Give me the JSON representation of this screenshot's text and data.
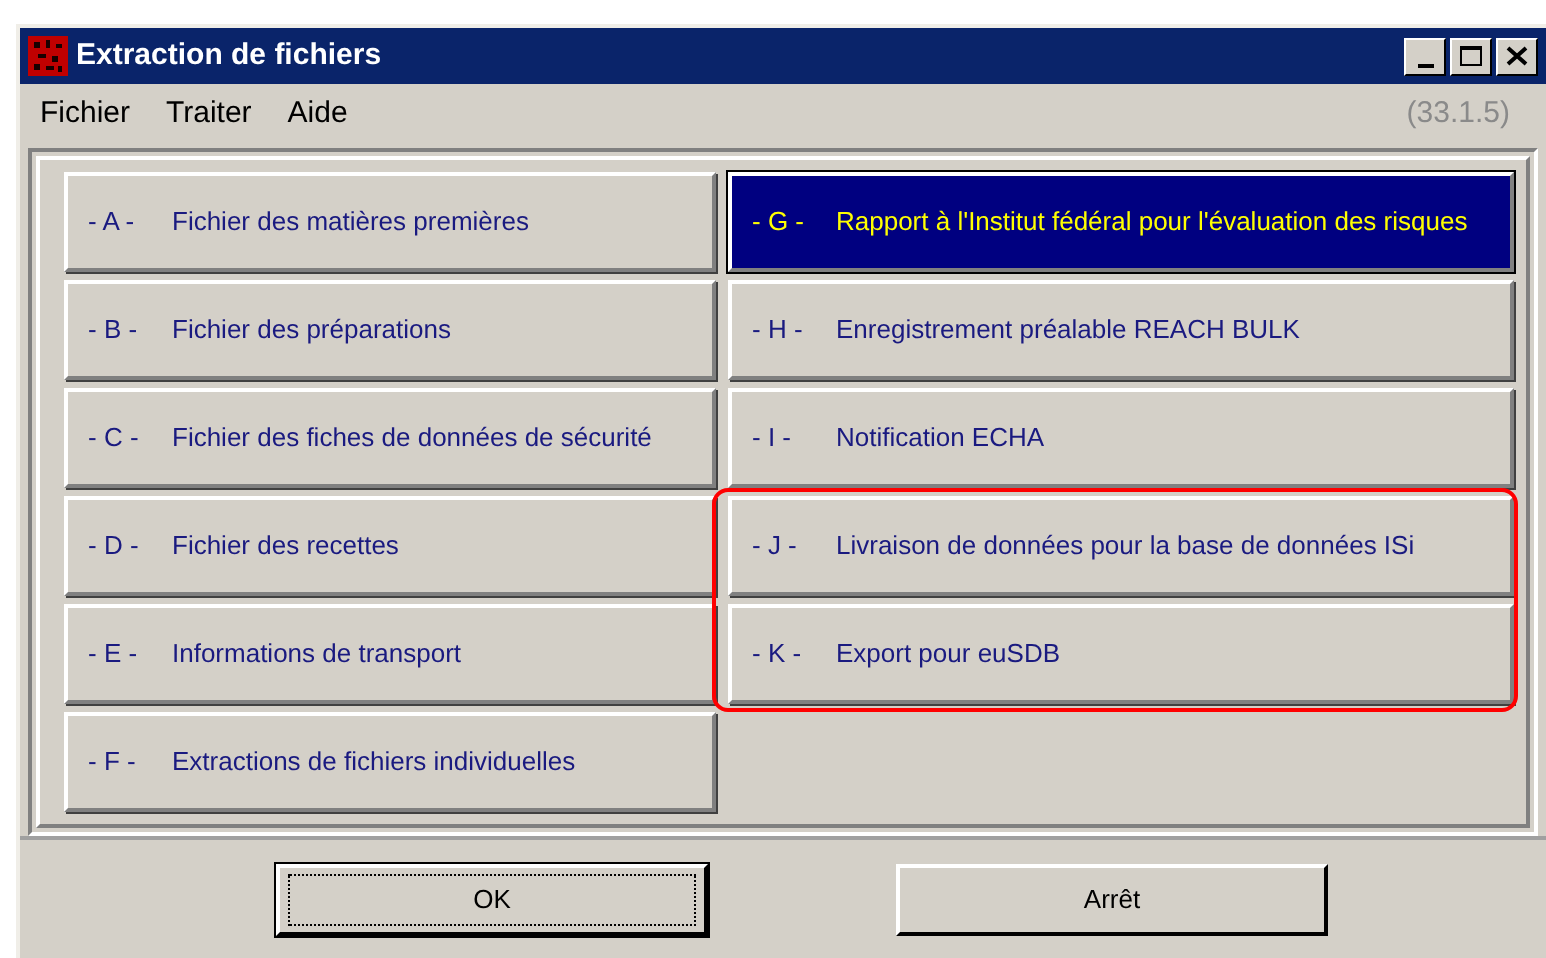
{
  "window": {
    "title": "Extraction de fichiers"
  },
  "menu": [
    {
      "label": "Fichier"
    },
    {
      "label": "Traiter"
    },
    {
      "label": "Aide"
    }
  ],
  "version": "(33.1.5)",
  "items": [
    {
      "code": "- A -",
      "label": "Fichier des matières premières",
      "selected": false,
      "circled": false
    },
    {
      "code": "- B -",
      "label": "Fichier des préparations",
      "selected": false,
      "circled": false
    },
    {
      "code": "- C -",
      "label": "Fichier des fiches de données de sécurité",
      "selected": false,
      "circled": false
    },
    {
      "code": "- D -",
      "label": "Fichier des recettes",
      "selected": false,
      "circled": false
    },
    {
      "code": "- E -",
      "label": "Informations de transport",
      "selected": false,
      "circled": false
    },
    {
      "code": "- F -",
      "label": "Extractions de fichiers individuelles",
      "selected": false,
      "circled": false
    },
    {
      "code": "- G -",
      "label": "Rapport à l'Institut fédéral pour l'évaluation des risques",
      "selected": true,
      "circled": false
    },
    {
      "code": "- H -",
      "label": "Enregistrement préalable REACH BULK",
      "selected": false,
      "circled": false
    },
    {
      "code": "- I -",
      "label": "Notification ECHA",
      "selected": false,
      "circled": false
    },
    {
      "code": "- J -",
      "label": "Livraison de données pour la base de données ISi",
      "selected": false,
      "circled": true
    },
    {
      "code": "- K -",
      "label": "Export pour euSDB",
      "selected": false,
      "circled": true
    }
  ],
  "buttons": [
    {
      "label": "OK",
      "focused": true
    },
    {
      "label": "Arrêt",
      "focused": false
    }
  ]
}
